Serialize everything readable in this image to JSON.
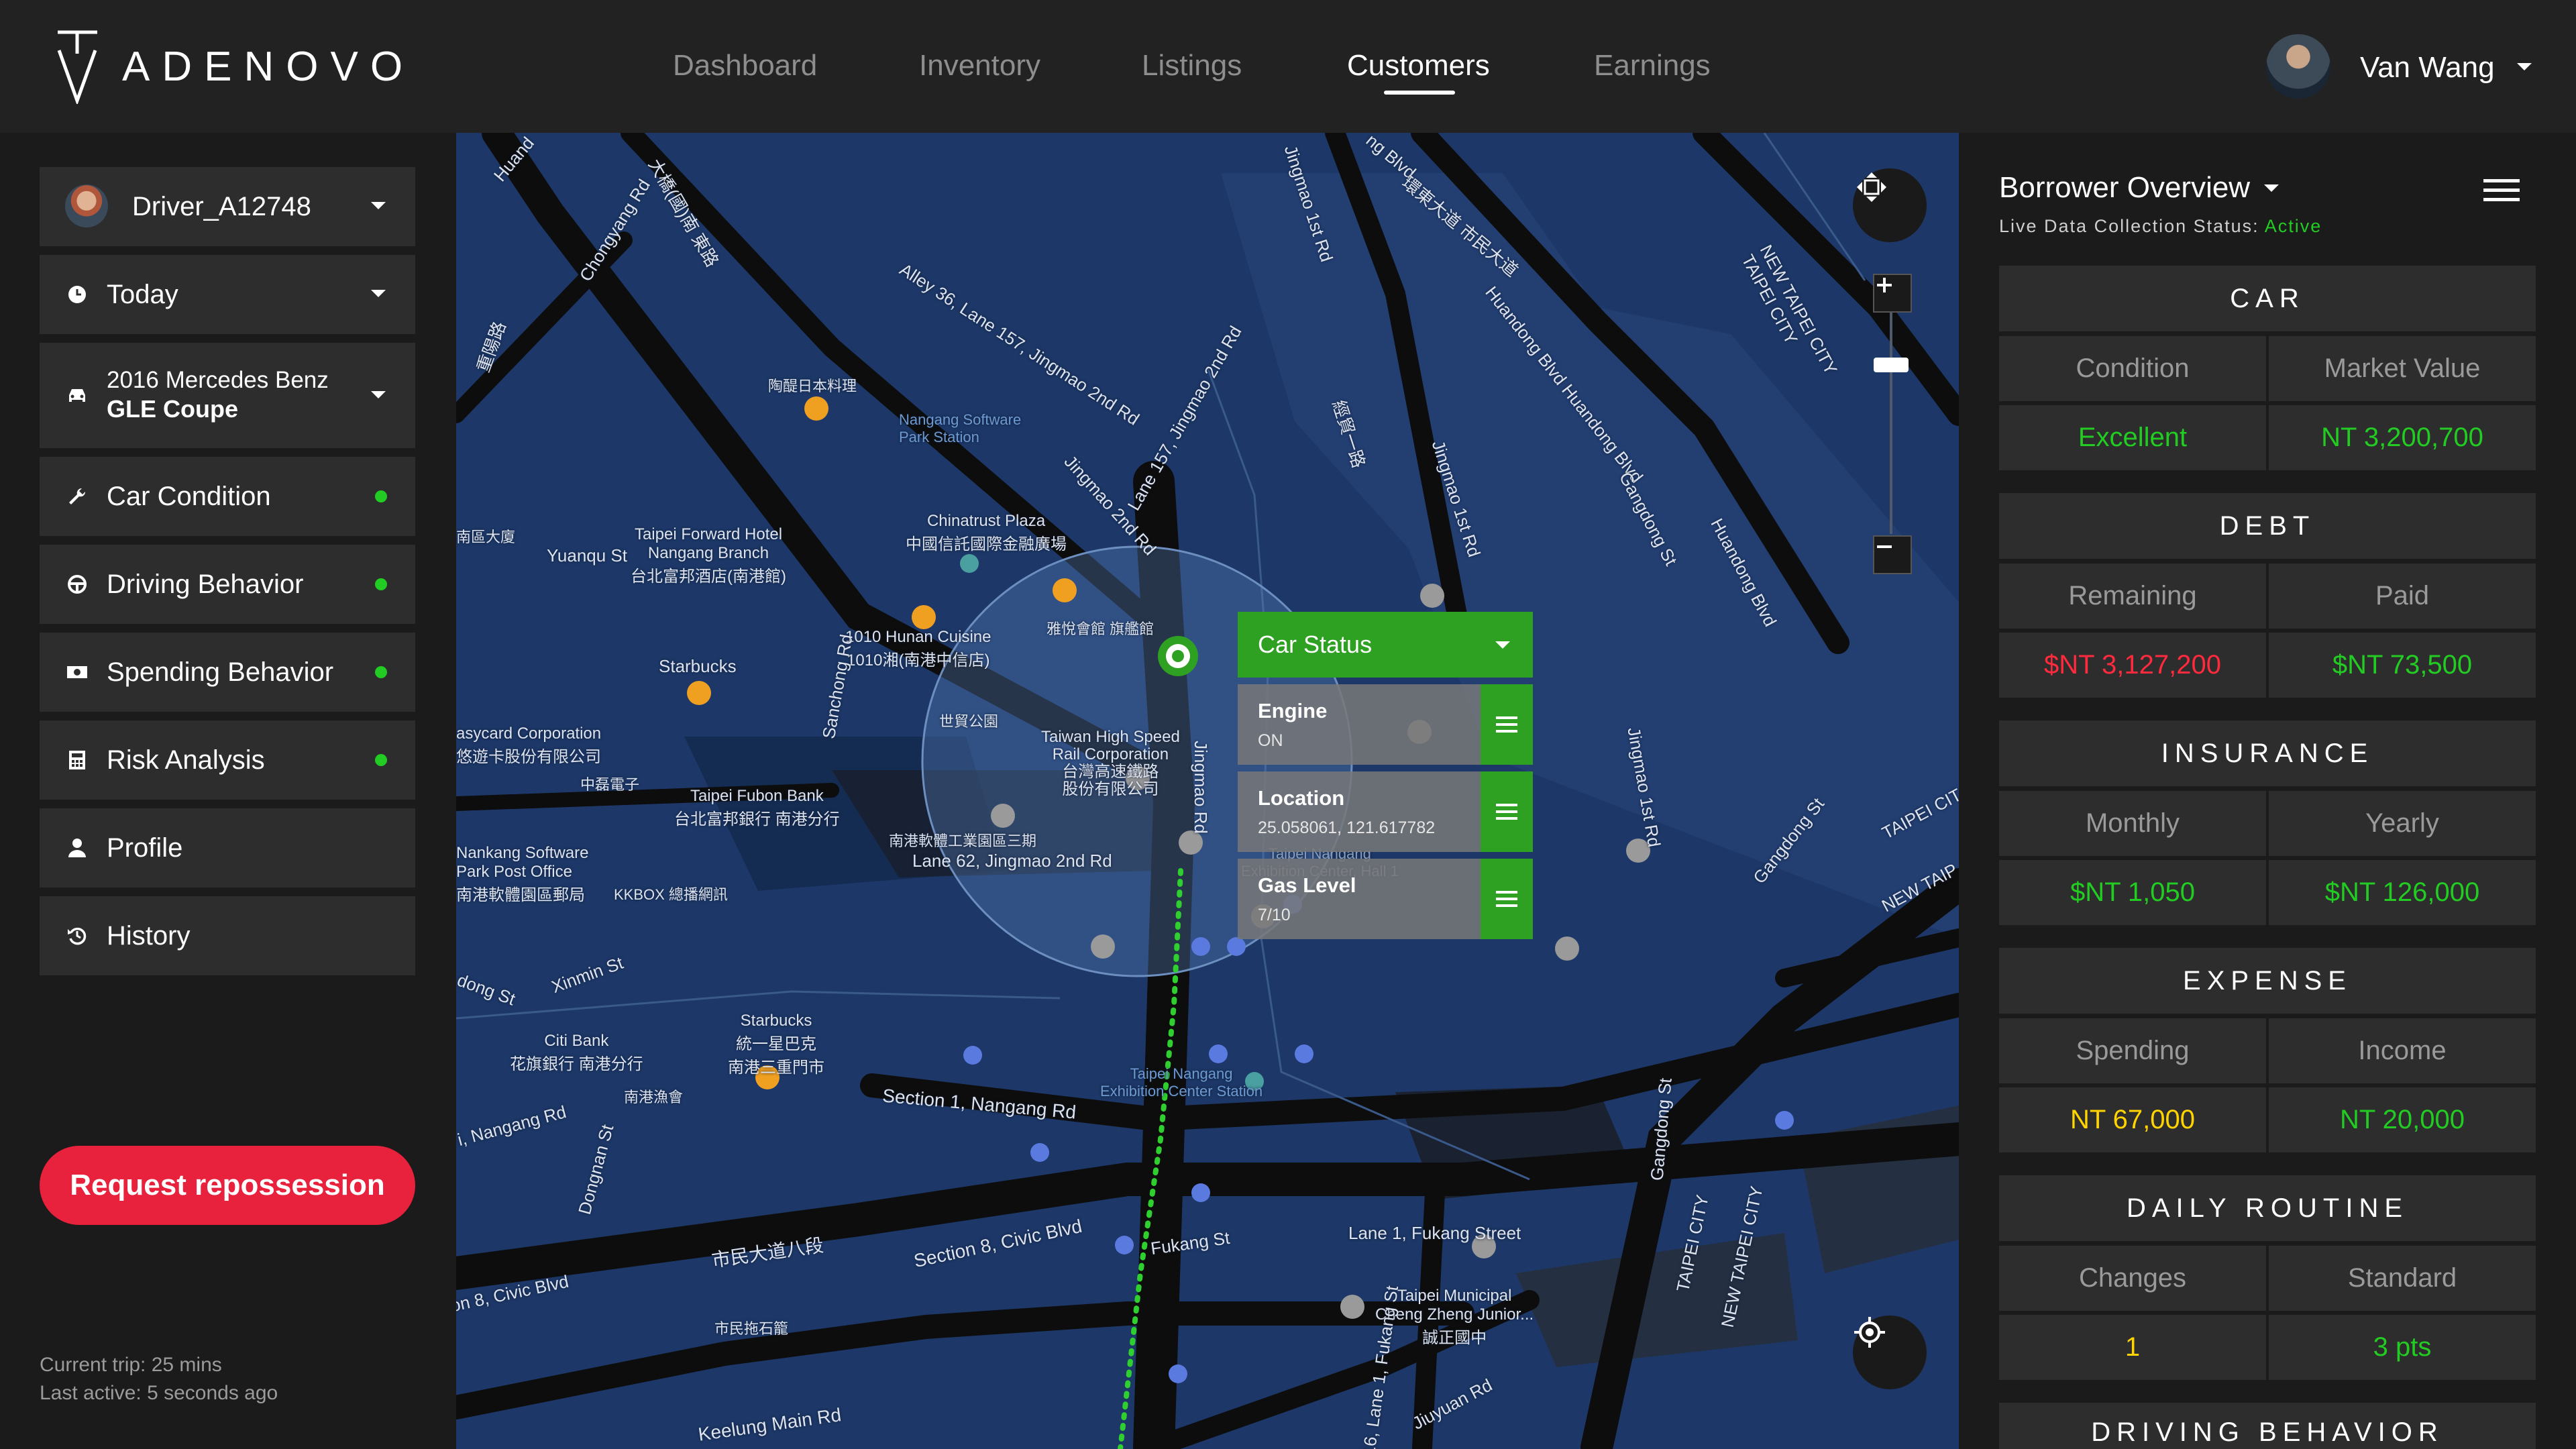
{
  "app": {
    "brand": "ADENOVO",
    "nav": [
      {
        "label": "Dashboard",
        "active": false
      },
      {
        "label": "Inventory",
        "active": false
      },
      {
        "label": "Listings",
        "active": false
      },
      {
        "label": "Customers",
        "active": true
      },
      {
        "label": "Earnings",
        "active": false
      }
    ],
    "user": {
      "name": "Van Wang"
    }
  },
  "sidebar": {
    "driver": "Driver_A12748",
    "period": "Today",
    "vehicle_line1": "2016 Mercedes Benz",
    "vehicle_line2": "GLE Coupe",
    "items": [
      {
        "label": "Car Condition",
        "icon": "wrench-icon",
        "status_dot": true
      },
      {
        "label": "Driving Behavior",
        "icon": "steering-wheel-icon",
        "status_dot": true
      },
      {
        "label": "Spending Behavior",
        "icon": "money-icon",
        "status_dot": true
      },
      {
        "label": "Risk Analysis",
        "icon": "calculator-icon",
        "status_dot": true
      },
      {
        "label": "Profile",
        "icon": "person-icon",
        "status_dot": false
      },
      {
        "label": "History",
        "icon": "history-icon",
        "status_dot": false
      }
    ],
    "repossession_button": "Request repossession",
    "current_trip": "Current trip: 25 mins",
    "last_active": "Last active: 5 seconds ago"
  },
  "map": {
    "labels": {
      "huang": "Huand",
      "chongyang": "Chongyang Rd",
      "wangpu": "重陽路",
      "dajiao": "大橋(國)南 東路",
      "alley36": "Alley 36, Lane 157, Jingmao 2nd Rd",
      "jingmao1st": "Jingmao 1st Rd",
      "civicblvd": "ng Blvd",
      "huandongChinese": "環東大道 市民大道",
      "huandongBlvd": "Huandong Blvd Huandong Blvd",
      "taoyuan": "陶醍日本料理",
      "nangangsoft": "Nangang Software\nPark Station",
      "lane157": "Lane 157, Jingmao 2nd Rd",
      "jingmao2nd": "Jingmao 2nd Rd",
      "zhuangjiu": "經貿一路",
      "jingmao1stRd": "Jingmao 1st Rd",
      "gangdong": "Gangdong St",
      "huandongBlvd2": "Huandong Blvd",
      "newtaipei": "NEW TAIPEI CITY\nTAIPEI CITY",
      "yuanqu": "Yuanqu St",
      "zhongqu": "南區大廈",
      "taipeiForward": "Taipei Forward Hotel\nNangang Branch\n台北富邦酒店(南港館)",
      "chinatrust": "Chinatrust Plaza\n中國信託國際金融廣場",
      "hunan": "1010 Hunan Cuisine\n1010湘(南港中信店)",
      "yueyue": "雅悅會館 旗艦館",
      "starbucks1": "Starbucks",
      "sanchong": "Sanchong Rd",
      "shimao": "世貿公園",
      "thsr": "Taiwan High Speed\nRail Corporation\n台灣高速鐵路\n股份有限公司",
      "easycard": "asycard Corporation\n悠遊卡股份有限公司",
      "zhongzheng": "中磊電子",
      "fubon": "Taipei Fubon Bank\n台北富邦銀行 南港分行",
      "nangangsoftpark": "南港軟體工業園區三期",
      "lane62": "Lane 62, Jingmao 2nd Rd",
      "nankangPost": "Nankang Software\nPark Post Office\n南港軟體園區郵局",
      "kkbox": "KKBOX 總播網訊",
      "jingmaoRd": "Jingmao Rd",
      "taipeiCity2": "TAIPEI CIT",
      "newtaipei2": "NEW TAIP",
      "gangdong2": "Gangdong St",
      "jingmao1st2": "Jingmao 1st Rd",
      "xinmin": "Xinmin St",
      "dong": "dong St",
      "citibank": "Citi Bank\n花旗銀行 南港分行",
      "starbucks2": "Starbucks\n統一星巴克\n南港三重門市",
      "section1": "Section 1, Nangang Rd",
      "nangangRd": "i, Nangang Rd",
      "dongnan": "Dongnan St",
      "nangangBakery": "南港漁會",
      "exhibition": "Taipei Nangang\nExhibition Center Station",
      "exhibitionHall": "Taipei Nangang\nExhibition Center, Hall 1",
      "gangdongSt3": "Gangdong St",
      "sec8civic": "on 8, Civic Blvd",
      "shimin": "市民大道八段",
      "section8civic": "Section 8, Civic Blvd",
      "fukang": "Fukang St",
      "lane1fukang": "Lane 1, Fukang Street",
      "chengzheng": "Taipei Municipal\nCheng Zheng Junior...\n誠正國中",
      "lane16": "16, Lane 1, Fukang St",
      "taipeiCity3": "TAIPEI CITY",
      "newtaipei3": "NEW TAIPEI CITY",
      "keelung": "Keelung Main Rd",
      "jiuyuan": "Jiuyuan Rd",
      "nangangMarket": "市民拖石籠"
    },
    "car_status": {
      "title": "Car Status",
      "rows": [
        {
          "key": "Engine",
          "value": "ON"
        },
        {
          "key": "Location",
          "value": "25.058061, 121.617782"
        },
        {
          "key": "Gas Level",
          "value": "7/10"
        }
      ]
    }
  },
  "panel": {
    "title": "Borrower Overview",
    "status_label": "Live Data Collection Status:",
    "status_value": "Active",
    "sections": [
      {
        "title": "CAR",
        "labels": [
          "Condition",
          "Market Value"
        ],
        "values": [
          "Excellent",
          "NT 3,200,700"
        ],
        "colors": [
          "green",
          "green"
        ]
      },
      {
        "title": "DEBT",
        "labels": [
          "Remaining",
          "Paid"
        ],
        "values": [
          "$NT 3,127,200",
          "$NT 73,500"
        ],
        "colors": [
          "red",
          "green"
        ]
      },
      {
        "title": "INSURANCE",
        "labels": [
          "Monthly",
          "Yearly"
        ],
        "values": [
          "$NT 1,050",
          "$NT 126,000"
        ],
        "colors": [
          "green",
          "green"
        ]
      },
      {
        "title": "EXPENSE",
        "labels": [
          "Spending",
          "Income"
        ],
        "values": [
          "NT 67,000",
          "NT 20,000"
        ],
        "colors": [
          "yellow",
          "green"
        ]
      },
      {
        "title": "DAILY ROUTINE",
        "labels": [
          "Changes",
          "Standard"
        ],
        "values": [
          "1",
          "3 pts"
        ],
        "colors": [
          "yellow",
          "green"
        ]
      },
      {
        "title": "DRIVING BEHAVIOR",
        "labels": [],
        "values": [],
        "colors": []
      }
    ]
  },
  "colors": {
    "accent_green": "#2ea022",
    "active_green": "#22cc22",
    "danger_red": "#e8213c",
    "value_red": "#ff2a3d",
    "value_yellow": "#ffd400",
    "map_blue": "#1e3a6a"
  }
}
